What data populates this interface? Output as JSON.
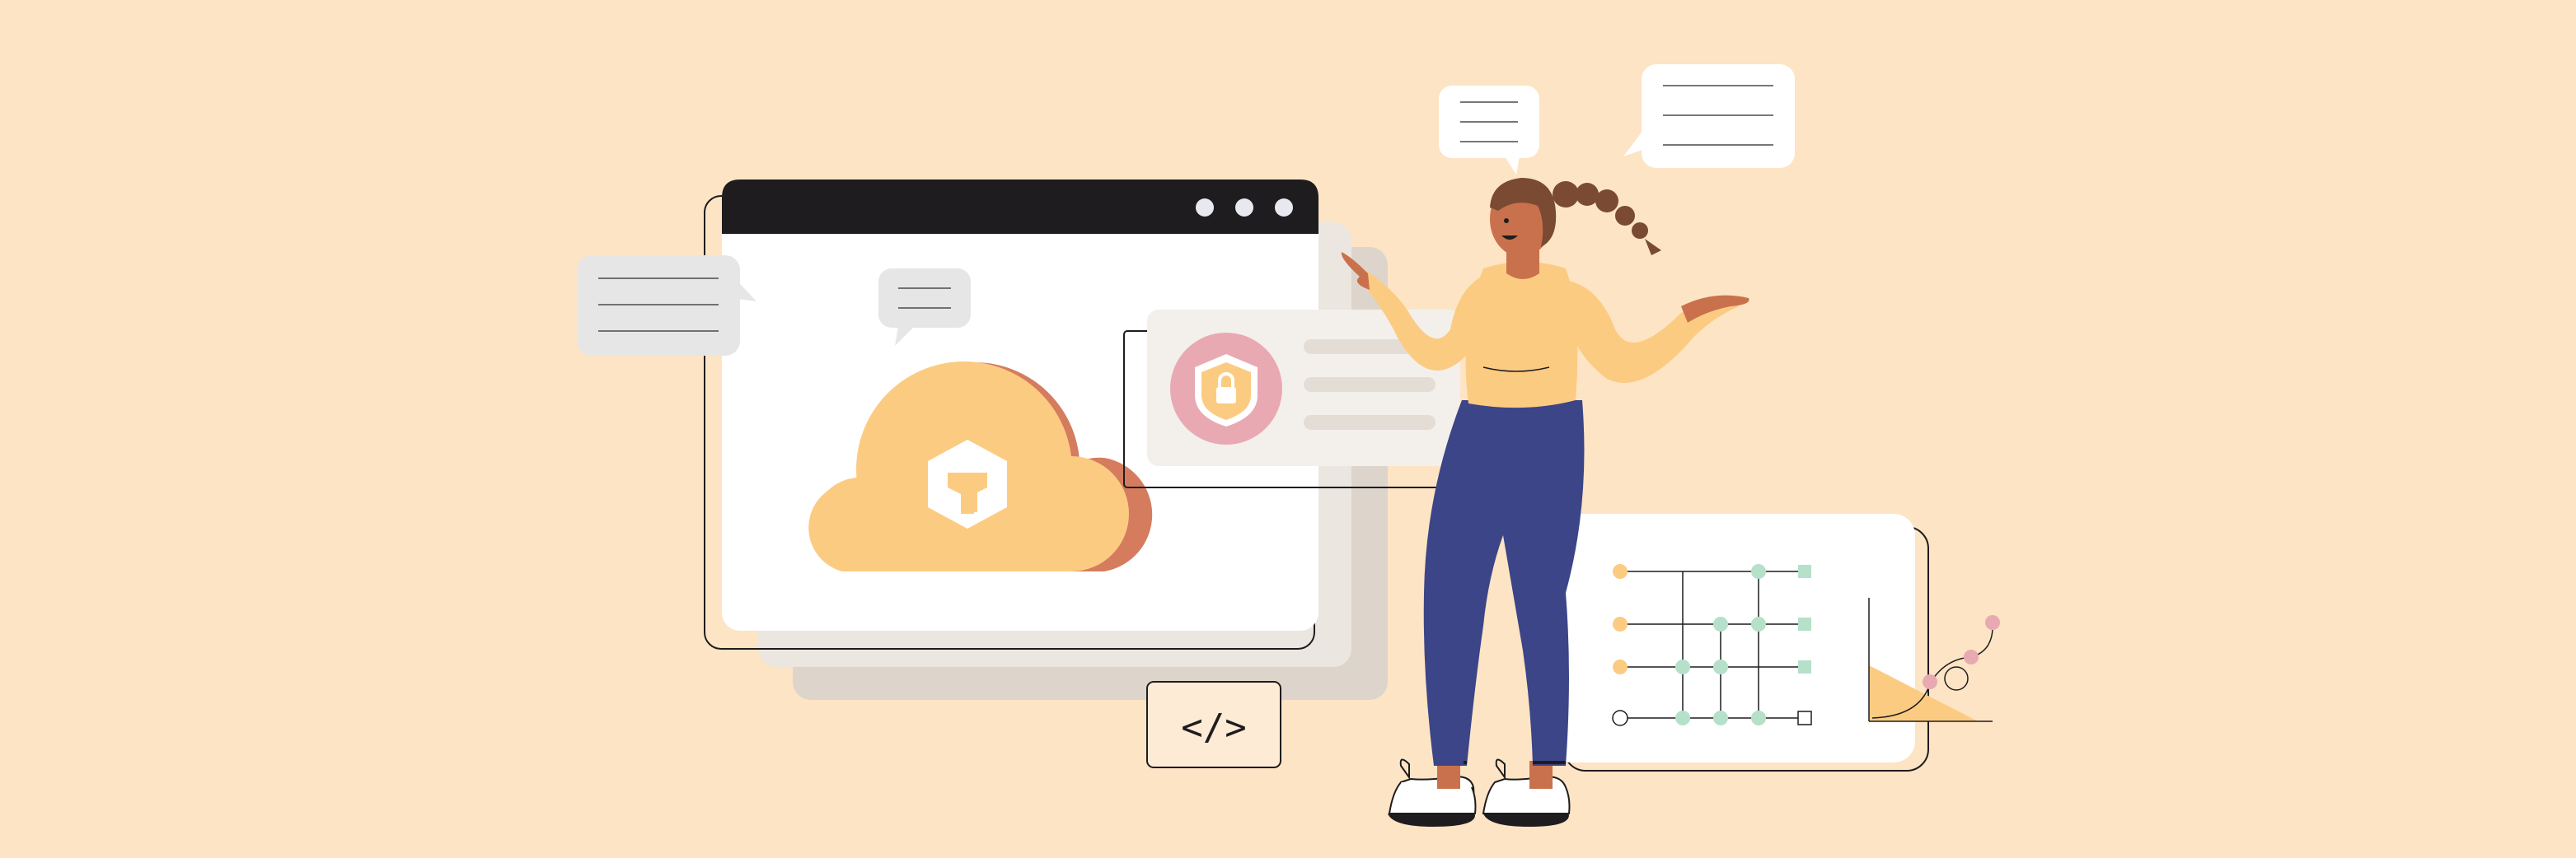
{
  "colors": {
    "background": "#fde4c4",
    "window_bar": "#1e1c1e",
    "window_body": "#ffffff",
    "shadow_1": "#ece6e0",
    "shadow_2": "#ddd5cc",
    "cloud": "#fccb82",
    "cloud_shadow": "#d57c5f",
    "shield_circle": "#e8a9b2",
    "shield": "#fccb82",
    "hair": "#7a4a33",
    "skin": "#c9714d",
    "sweater": "#fccb82",
    "pants": "#3b4587",
    "node_teal": "#b5e0c9",
    "node_orange": "#fccb82",
    "node_pink": "#e8a9b2",
    "outline": "#1e1c1e"
  },
  "code_badge": {
    "text": "</>"
  },
  "icons": {
    "cloud": "cloud-icon",
    "logo": "hexagon-logo-icon",
    "shield": "shield-lock-icon",
    "chart": "area-chart-icon",
    "network": "circuit-diagram-icon"
  }
}
